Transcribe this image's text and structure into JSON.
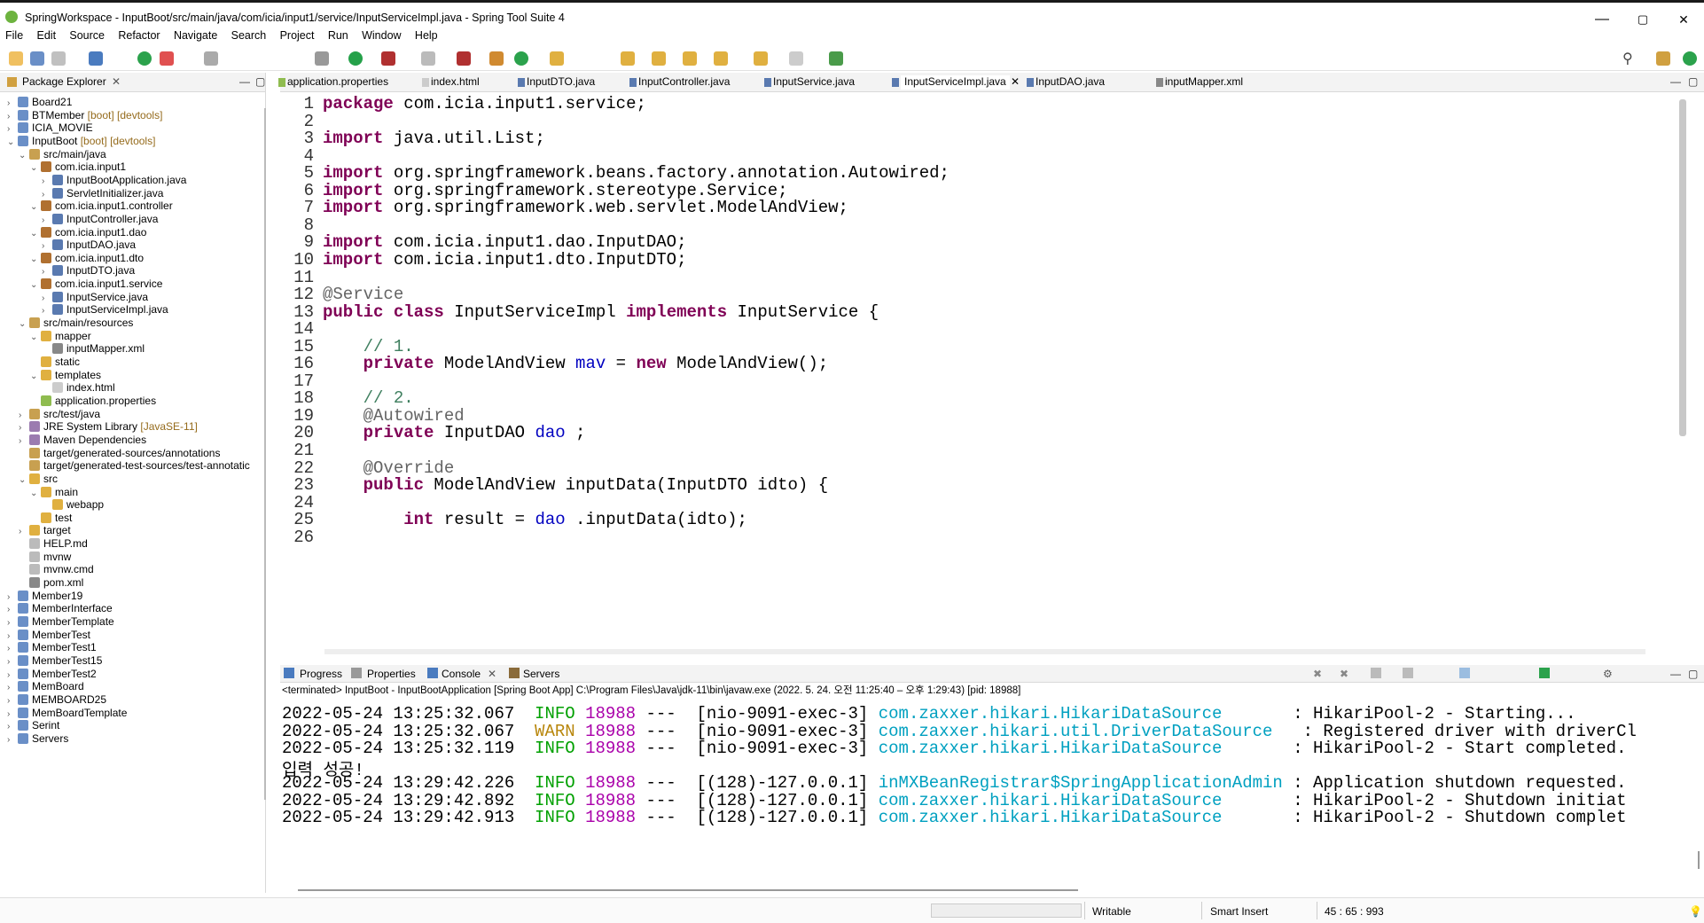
{
  "window": {
    "title": "SpringWorkspace - InputBoot/src/main/java/com/icia/input1/service/InputServiceImpl.java - Spring Tool Suite 4",
    "minimize": "—",
    "maximize": "▢",
    "close": "✕"
  },
  "menu": [
    "File",
    "Edit",
    "Source",
    "Refactor",
    "Navigate",
    "Search",
    "Project",
    "Run",
    "Window",
    "Help"
  ],
  "package_explorer": {
    "title": "Package Explorer",
    "items": [
      {
        "label": "Board21",
        "indent": 0,
        "arrow": "›",
        "icon": "project"
      },
      {
        "label": "BTMember",
        "deco": "[boot] [devtools]",
        "indent": 0,
        "arrow": "›",
        "icon": "project"
      },
      {
        "label": "ICIA_MOVIE",
        "indent": 0,
        "arrow": "›",
        "icon": "project"
      },
      {
        "label": "InputBoot",
        "deco": "[boot] [devtools]",
        "indent": 0,
        "arrow": "⌄",
        "icon": "project"
      },
      {
        "label": "src/main/java",
        "indent": 1,
        "arrow": "⌄",
        "icon": "srcfolder"
      },
      {
        "label": "com.icia.input1",
        "indent": 2,
        "arrow": "⌄",
        "icon": "package"
      },
      {
        "label": "InputBootApplication.java",
        "indent": 3,
        "arrow": "›",
        "icon": "java"
      },
      {
        "label": "ServletInitializer.java",
        "indent": 3,
        "arrow": "›",
        "icon": "java"
      },
      {
        "label": "com.icia.input1.controller",
        "indent": 2,
        "arrow": "⌄",
        "icon": "package"
      },
      {
        "label": "InputController.java",
        "indent": 3,
        "arrow": "›",
        "icon": "java"
      },
      {
        "label": "com.icia.input1.dao",
        "indent": 2,
        "arrow": "⌄",
        "icon": "package"
      },
      {
        "label": "InputDAO.java",
        "indent": 3,
        "arrow": "›",
        "icon": "java"
      },
      {
        "label": "com.icia.input1.dto",
        "indent": 2,
        "arrow": "⌄",
        "icon": "package"
      },
      {
        "label": "InputDTO.java",
        "indent": 3,
        "arrow": "›",
        "icon": "java"
      },
      {
        "label": "com.icia.input1.service",
        "indent": 2,
        "arrow": "⌄",
        "icon": "package"
      },
      {
        "label": "InputService.java",
        "indent": 3,
        "arrow": "›",
        "icon": "java"
      },
      {
        "label": "InputServiceImpl.java",
        "indent": 3,
        "arrow": "›",
        "icon": "java"
      },
      {
        "label": "src/main/resources",
        "indent": 1,
        "arrow": "⌄",
        "icon": "srcfolder"
      },
      {
        "label": "mapper",
        "indent": 2,
        "arrow": "⌄",
        "icon": "folder"
      },
      {
        "label": "inputMapper.xml",
        "indent": 3,
        "arrow": "",
        "icon": "xml"
      },
      {
        "label": "static",
        "indent": 2,
        "arrow": "",
        "icon": "folder"
      },
      {
        "label": "templates",
        "indent": 2,
        "arrow": "⌄",
        "icon": "folder"
      },
      {
        "label": "index.html",
        "indent": 3,
        "arrow": "",
        "icon": "html"
      },
      {
        "label": "application.properties",
        "indent": 2,
        "arrow": "",
        "icon": "props"
      },
      {
        "label": "src/test/java",
        "indent": 1,
        "arrow": "›",
        "icon": "srcfolder"
      },
      {
        "label": "JRE System Library",
        "deco": "[JavaSE-11]",
        "indent": 1,
        "arrow": "›",
        "icon": "lib"
      },
      {
        "label": "Maven Dependencies",
        "indent": 1,
        "arrow": "›",
        "icon": "lib"
      },
      {
        "label": "target/generated-sources/annotations",
        "indent": 1,
        "arrow": "",
        "icon": "srcfolder"
      },
      {
        "label": "target/generated-test-sources/test-annotatic",
        "indent": 1,
        "arrow": "",
        "icon": "srcfolder"
      },
      {
        "label": "src",
        "indent": 1,
        "arrow": "⌄",
        "icon": "folder"
      },
      {
        "label": "main",
        "indent": 2,
        "arrow": "⌄",
        "icon": "folder"
      },
      {
        "label": "webapp",
        "indent": 3,
        "arrow": "",
        "icon": "folder"
      },
      {
        "label": "test",
        "indent": 2,
        "arrow": "",
        "icon": "folder"
      },
      {
        "label": "target",
        "indent": 1,
        "arrow": "›",
        "icon": "folder"
      },
      {
        "label": "HELP.md",
        "indent": 1,
        "arrow": "",
        "icon": "file"
      },
      {
        "label": "mvnw",
        "indent": 1,
        "arrow": "",
        "icon": "file"
      },
      {
        "label": "mvnw.cmd",
        "indent": 1,
        "arrow": "",
        "icon": "file"
      },
      {
        "label": "pom.xml",
        "indent": 1,
        "arrow": "",
        "icon": "xml"
      },
      {
        "label": "Member19",
        "indent": 0,
        "arrow": "›",
        "icon": "project"
      },
      {
        "label": "MemberInterface",
        "indent": 0,
        "arrow": "›",
        "icon": "project"
      },
      {
        "label": "MemberTemplate",
        "indent": 0,
        "arrow": "›",
        "icon": "project"
      },
      {
        "label": "MemberTest",
        "indent": 0,
        "arrow": "›",
        "icon": "project"
      },
      {
        "label": "MemberTest1",
        "indent": 0,
        "arrow": "›",
        "icon": "project"
      },
      {
        "label": "MemberTest15",
        "indent": 0,
        "arrow": "›",
        "icon": "project"
      },
      {
        "label": "MemberTest2",
        "indent": 0,
        "arrow": "›",
        "icon": "project"
      },
      {
        "label": "MemBoard",
        "indent": 0,
        "arrow": "›",
        "icon": "project"
      },
      {
        "label": "MEMBOARD25",
        "indent": 0,
        "arrow": "›",
        "icon": "project"
      },
      {
        "label": "MemBoardTemplate",
        "indent": 0,
        "arrow": "›",
        "icon": "project"
      },
      {
        "label": "Serint",
        "indent": 0,
        "arrow": "›",
        "icon": "project"
      },
      {
        "label": "Servers",
        "indent": 0,
        "arrow": "›",
        "icon": "project"
      }
    ]
  },
  "editor_tabs": [
    "application.properties",
    "index.html",
    "InputDTO.java",
    "InputController.java",
    "InputService.java",
    "InputServiceImpl.java",
    "InputDAO.java",
    "inputMapper.xml"
  ],
  "active_tab": "InputServiceImpl.java",
  "code_lines": [
    {
      "n": "1",
      "segs": [
        [
          "kw",
          "package"
        ],
        [
          "",
          "com.icia.input1.service;"
        ]
      ]
    },
    {
      "n": "2",
      "segs": []
    },
    {
      "n": "3",
      "segs": [
        [
          "kw",
          "import"
        ],
        [
          "",
          "java.util.List;"
        ]
      ]
    },
    {
      "n": "4",
      "segs": []
    },
    {
      "n": "5",
      "segs": [
        [
          "kw",
          "import"
        ],
        [
          "",
          "org.springframework.beans.factory.annotation.Autowired;"
        ]
      ]
    },
    {
      "n": "6",
      "segs": [
        [
          "kw",
          "import"
        ],
        [
          "",
          "org.springframework.stereotype.Service;"
        ]
      ]
    },
    {
      "n": "7",
      "segs": [
        [
          "kw",
          "import"
        ],
        [
          "",
          "org.springframework.web.servlet.ModelAndView;"
        ]
      ]
    },
    {
      "n": "8",
      "segs": []
    },
    {
      "n": "9",
      "segs": [
        [
          "kw",
          "import"
        ],
        [
          "",
          "com.icia.input1.dao.InputDAO;"
        ]
      ]
    },
    {
      "n": "10",
      "segs": [
        [
          "kw",
          "import"
        ],
        [
          "",
          "com.icia.input1.dto.InputDTO;"
        ]
      ]
    },
    {
      "n": "11",
      "segs": []
    },
    {
      "n": "12",
      "segs": [
        [
          "an",
          "@Service"
        ]
      ]
    },
    {
      "n": "13",
      "segs": [
        [
          "kw",
          "public"
        ],
        [
          "kw",
          "class"
        ],
        [
          "",
          "InputServiceImpl"
        ],
        [
          "kw",
          "implements"
        ],
        [
          "",
          "InputService {"
        ]
      ]
    },
    {
      "n": "14",
      "segs": []
    },
    {
      "n": "15",
      "segs": [
        [
          "cm",
          "    // 1."
        ]
      ]
    },
    {
      "n": "16",
      "segs": [
        [
          "kw",
          "    private"
        ],
        [
          "",
          "ModelAndView"
        ],
        [
          "fd",
          "mav"
        ],
        [
          "",
          "="
        ],
        [
          "kw",
          "new"
        ],
        [
          "",
          "ModelAndView();"
        ]
      ]
    },
    {
      "n": "17",
      "segs": []
    },
    {
      "n": "18",
      "segs": [
        [
          "cm",
          "    // 2."
        ]
      ]
    },
    {
      "n": "19",
      "segs": [
        [
          "an",
          "    @Autowired"
        ]
      ]
    },
    {
      "n": "20",
      "segs": [
        [
          "kw",
          "    private"
        ],
        [
          "",
          "InputDAO"
        ],
        [
          "fd",
          "dao"
        ],
        [
          "",
          ";"
        ]
      ]
    },
    {
      "n": "21",
      "segs": []
    },
    {
      "n": "22",
      "segs": [
        [
          "an",
          "    @Override"
        ]
      ]
    },
    {
      "n": "23",
      "segs": [
        [
          "kw",
          "    public"
        ],
        [
          "",
          "ModelAndView inputData(InputDTO idto) {"
        ]
      ]
    },
    {
      "n": "24",
      "segs": []
    },
    {
      "n": "25",
      "segs": [
        [
          "kw",
          "        int"
        ],
        [
          "",
          "result ="
        ],
        [
          "fd",
          "dao"
        ],
        [
          "",
          ".inputData(idto);"
        ]
      ]
    },
    {
      "n": "26",
      "segs": []
    }
  ],
  "console": {
    "tabs": [
      "Progress",
      "Properties",
      "Console",
      "Servers"
    ],
    "header": "<terminated> InputBoot - InputBootApplication [Spring Boot App] C:\\Program Files\\Java\\jdk-11\\bin\\javaw.exe  (2022. 5. 24. 오전 11:25:40 – 오후 1:29:43) [pid: 18988]",
    "rows": [
      {
        "ts": "2022-05-24 13:25:32.067",
        "lvl": "INFO",
        "pid": "18988",
        "thr": "---  [nio-9091-exec-3]",
        "logger": "com.zaxxer.hikari.HikariDataSource      ",
        "msg": ": HikariPool-2 - Starting..."
      },
      {
        "ts": "2022-05-24 13:25:32.067",
        "lvl": "WARN",
        "pid": "18988",
        "thr": "---  [nio-9091-exec-3]",
        "logger": "com.zaxxer.hikari.util.DriverDataSource  ",
        "msg": ": Registered driver with driverCl"
      },
      {
        "ts": "2022-05-24 13:25:32.119",
        "lvl": "INFO",
        "pid": "18988",
        "thr": "---  [nio-9091-exec-3]",
        "logger": "com.zaxxer.hikari.HikariDataSource      ",
        "msg": ": HikariPool-2 - Start completed."
      },
      {
        "plain": "입력 성공!"
      },
      {
        "ts": "2022-05-24 13:29:42.226",
        "lvl": "INFO",
        "pid": "18988",
        "thr": "---  [(128)-127.0.0.1]",
        "logger": "inMXBeanRegistrar$SpringApplicationAdmin",
        "msg": ": Application shutdown requested."
      },
      {
        "ts": "2022-05-24 13:29:42.892",
        "lvl": "INFO",
        "pid": "18988",
        "thr": "---  [(128)-127.0.0.1]",
        "logger": "com.zaxxer.hikari.HikariDataSource      ",
        "msg": ": HikariPool-2 - Shutdown initiat"
      },
      {
        "ts": "2022-05-24 13:29:42.913",
        "lvl": "INFO",
        "pid": "18988",
        "thr": "---  [(128)-127.0.0.1]",
        "logger": "com.zaxxer.hikari.HikariDataSource      ",
        "msg": ": HikariPool-2 - Shutdown complet"
      }
    ]
  },
  "status": {
    "writable": "Writable",
    "insert": "Smart Insert",
    "position": "45 : 65 : 993"
  },
  "colors": {
    "keyword": "#7f0055",
    "comment": "#3f7f5f",
    "field": "#0000c0",
    "info": "#00a000",
    "logger": "#00a0c0"
  }
}
